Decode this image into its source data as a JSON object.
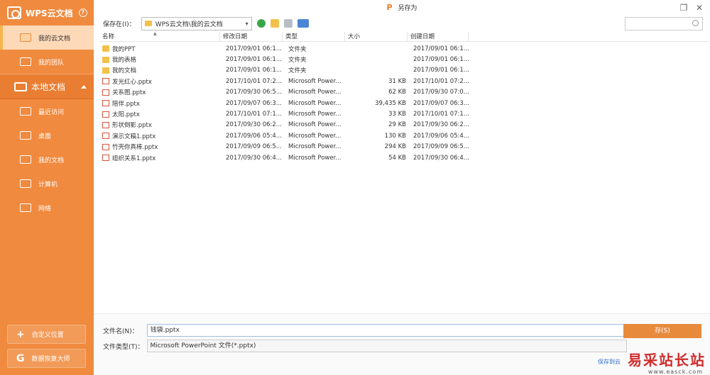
{
  "window": {
    "title": "另存为",
    "logo_glyph": "P",
    "restore_glyph": "❐",
    "close_glyph": "✕"
  },
  "sidebar": {
    "brand": "WPS云文档",
    "help_glyph": "?",
    "cloud_items": [
      {
        "label": "我的云文档",
        "icon": "cloud-doc-icon",
        "active": true
      },
      {
        "label": "我的团队",
        "icon": "team-icon",
        "active": false
      }
    ],
    "local_section": "本地文档",
    "local_items": [
      {
        "label": "最近访问",
        "icon": "recent-icon"
      },
      {
        "label": "桌面",
        "icon": "desktop-icon"
      },
      {
        "label": "我的文档",
        "icon": "documents-icon"
      },
      {
        "label": "计算机",
        "icon": "computer-icon"
      },
      {
        "label": "网络",
        "icon": "network-icon"
      }
    ],
    "custom_location": "自定义位置",
    "custom_glyph": "+",
    "recovery": "数据恢复大师",
    "recovery_glyph": "G"
  },
  "toolbar": {
    "save_in_label": "保存在(I)：",
    "path": "WPS云文档\\我的云文档",
    "path_caret": "▾",
    "sort_caret": "▲"
  },
  "search": {
    "placeholder": ""
  },
  "columns": {
    "name": "名称",
    "modified": "修改日期",
    "type": "类型",
    "size": "大小",
    "created": "创建日期"
  },
  "files": [
    {
      "name": "我的PPT",
      "kind": "folder",
      "sync": false,
      "modified": "2017/09/01 06:1...",
      "type": "文件夹",
      "size": "",
      "created": "2017/09/01 06:1..."
    },
    {
      "name": "我的表格",
      "kind": "folder",
      "sync": false,
      "modified": "2017/09/01 06:1...",
      "type": "文件夹",
      "size": "",
      "created": "2017/09/01 06:1..."
    },
    {
      "name": "我的文档",
      "kind": "folder",
      "sync": false,
      "modified": "2017/09/01 06:1...",
      "type": "文件夹",
      "size": "",
      "created": "2017/09/01 06:1..."
    },
    {
      "name": "发光红心.pptx",
      "kind": "ppt",
      "sync": true,
      "modified": "2017/10/01 07:2...",
      "type": "Microsoft Power...",
      "size": "31 KB",
      "created": "2017/10/01 07:2..."
    },
    {
      "name": "关系图.pptx",
      "kind": "ppt",
      "sync": true,
      "modified": "2017/09/30 06:5...",
      "type": "Microsoft Power...",
      "size": "62 KB",
      "created": "2017/09/30 07:0..."
    },
    {
      "name": "陪伴.pptx",
      "kind": "ppt",
      "sync": false,
      "modified": "2017/09/07 06:3...",
      "type": "Microsoft Power...",
      "size": "39,435 KB",
      "created": "2017/09/07 06:3..."
    },
    {
      "name": "太阳.pptx",
      "kind": "ppt",
      "sync": true,
      "modified": "2017/10/01 07:1...",
      "type": "Microsoft Power...",
      "size": "33 KB",
      "created": "2017/10/01 07:1..."
    },
    {
      "name": "形状倒影.pptx",
      "kind": "ppt",
      "sync": true,
      "modified": "2017/09/30 06:2...",
      "type": "Microsoft Power...",
      "size": "29 KB",
      "created": "2017/09/30 06:2..."
    },
    {
      "name": "演示文稿1.pptx",
      "kind": "ppt",
      "sync": true,
      "modified": "2017/09/06 05:4...",
      "type": "Microsoft Power...",
      "size": "130 KB",
      "created": "2017/09/06 05:4..."
    },
    {
      "name": "竹壳你真棒.pptx",
      "kind": "ppt",
      "sync": true,
      "modified": "2017/09/09 06:5...",
      "type": "Microsoft Power...",
      "size": "294 KB",
      "created": "2017/09/09 06:5..."
    },
    {
      "name": "组织关系1.pptx",
      "kind": "ppt",
      "sync": true,
      "modified": "2017/09/30 06:4...",
      "type": "Microsoft Power...",
      "size": "54 KB",
      "created": "2017/09/30 06:4..."
    }
  ],
  "form": {
    "filename_label": "文件名(N)：",
    "filename_value": "钱袋.pptx",
    "filetype_label": "文件类型(T)：",
    "filetype_value": "Microsoft PowerPoint 文件(*.pptx)",
    "save_button": "存(S)",
    "cloud_link": "保存到云"
  },
  "watermark": {
    "text": "易采站长站",
    "sub": "www.easck.com"
  },
  "colors": {
    "accent": "#f08a3e",
    "active_bg": "#fdd9b8",
    "sync_green": "#4cb84a"
  }
}
